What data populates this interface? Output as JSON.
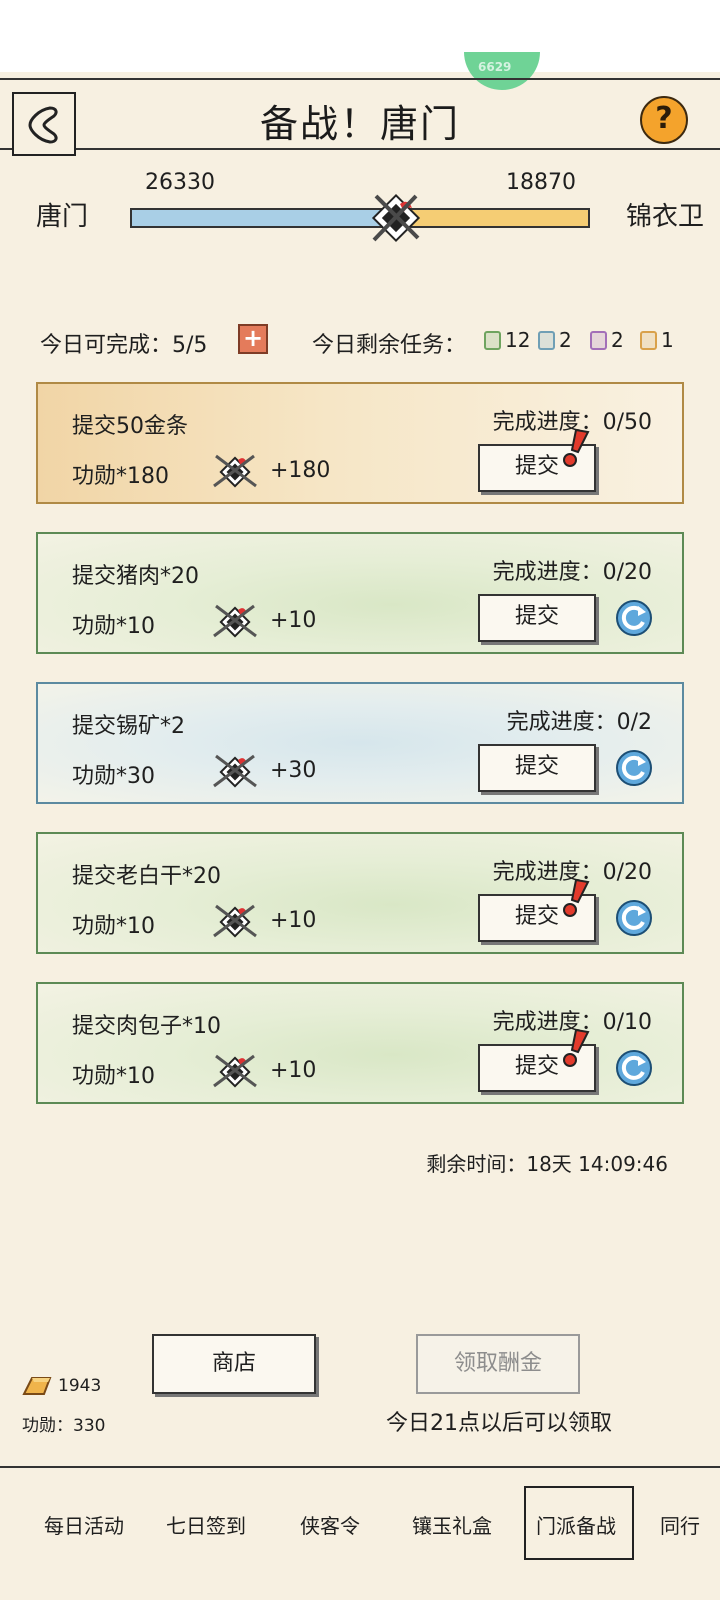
{
  "header": {
    "badge_text": "6629",
    "title": "备战！唐门",
    "help_symbol": "?"
  },
  "versus": {
    "left_name": "唐门",
    "right_name": "锦衣卫",
    "left_score": "26330",
    "right_score": "18870",
    "left_ratio": 0.58,
    "colors": {
      "left": "#a9cfe6",
      "right": "#f5cd74"
    }
  },
  "stats": {
    "today_complete": "今日可完成：5/5",
    "remaining_label": "今日剩余任务：",
    "counters": [
      {
        "value": "12",
        "color": "#6fa45f"
      },
      {
        "value": "2",
        "color": "#6f9fb5"
      },
      {
        "value": "2",
        "color": "#a36fb8"
      },
      {
        "value": "1",
        "color": "#d9a14a"
      }
    ]
  },
  "tasks": [
    {
      "title": "提交50金条",
      "reward": "功勋*180",
      "plus": "+180",
      "progress": "完成进度：0/50",
      "submit": "提交",
      "tier": "gold",
      "alert": true,
      "refresh": false
    },
    {
      "title": "提交猪肉*20",
      "reward": "功勋*10",
      "plus": "+10",
      "progress": "完成进度：0/20",
      "submit": "提交",
      "tier": "green",
      "alert": false,
      "refresh": true
    },
    {
      "title": "提交锡矿*2",
      "reward": "功勋*30",
      "plus": "+30",
      "progress": "完成进度：0/2",
      "submit": "提交",
      "tier": "blue",
      "alert": false,
      "refresh": true
    },
    {
      "title": "提交老白干*20",
      "reward": "功勋*10",
      "plus": "+10",
      "progress": "完成进度：0/20",
      "submit": "提交",
      "tier": "green",
      "alert": true,
      "refresh": true
    },
    {
      "title": "提交肉包子*10",
      "reward": "功勋*10",
      "plus": "+10",
      "progress": "完成进度：0/10",
      "submit": "提交",
      "tier": "green",
      "alert": true,
      "refresh": true
    }
  ],
  "timer": "剩余时间：18天 14:09:46",
  "footer": {
    "shop": "商店",
    "claim": "领取酬金",
    "claim_hint": "今日21点以后可以领取",
    "gold_count": "1943",
    "merit": "功勋：330"
  },
  "tabs": [
    {
      "label": "每日活动"
    },
    {
      "label": "七日签到"
    },
    {
      "label": "侠客令"
    },
    {
      "label": "镶玉礼盒"
    },
    {
      "label": "门派备战",
      "active": true
    },
    {
      "label": "同行"
    }
  ]
}
